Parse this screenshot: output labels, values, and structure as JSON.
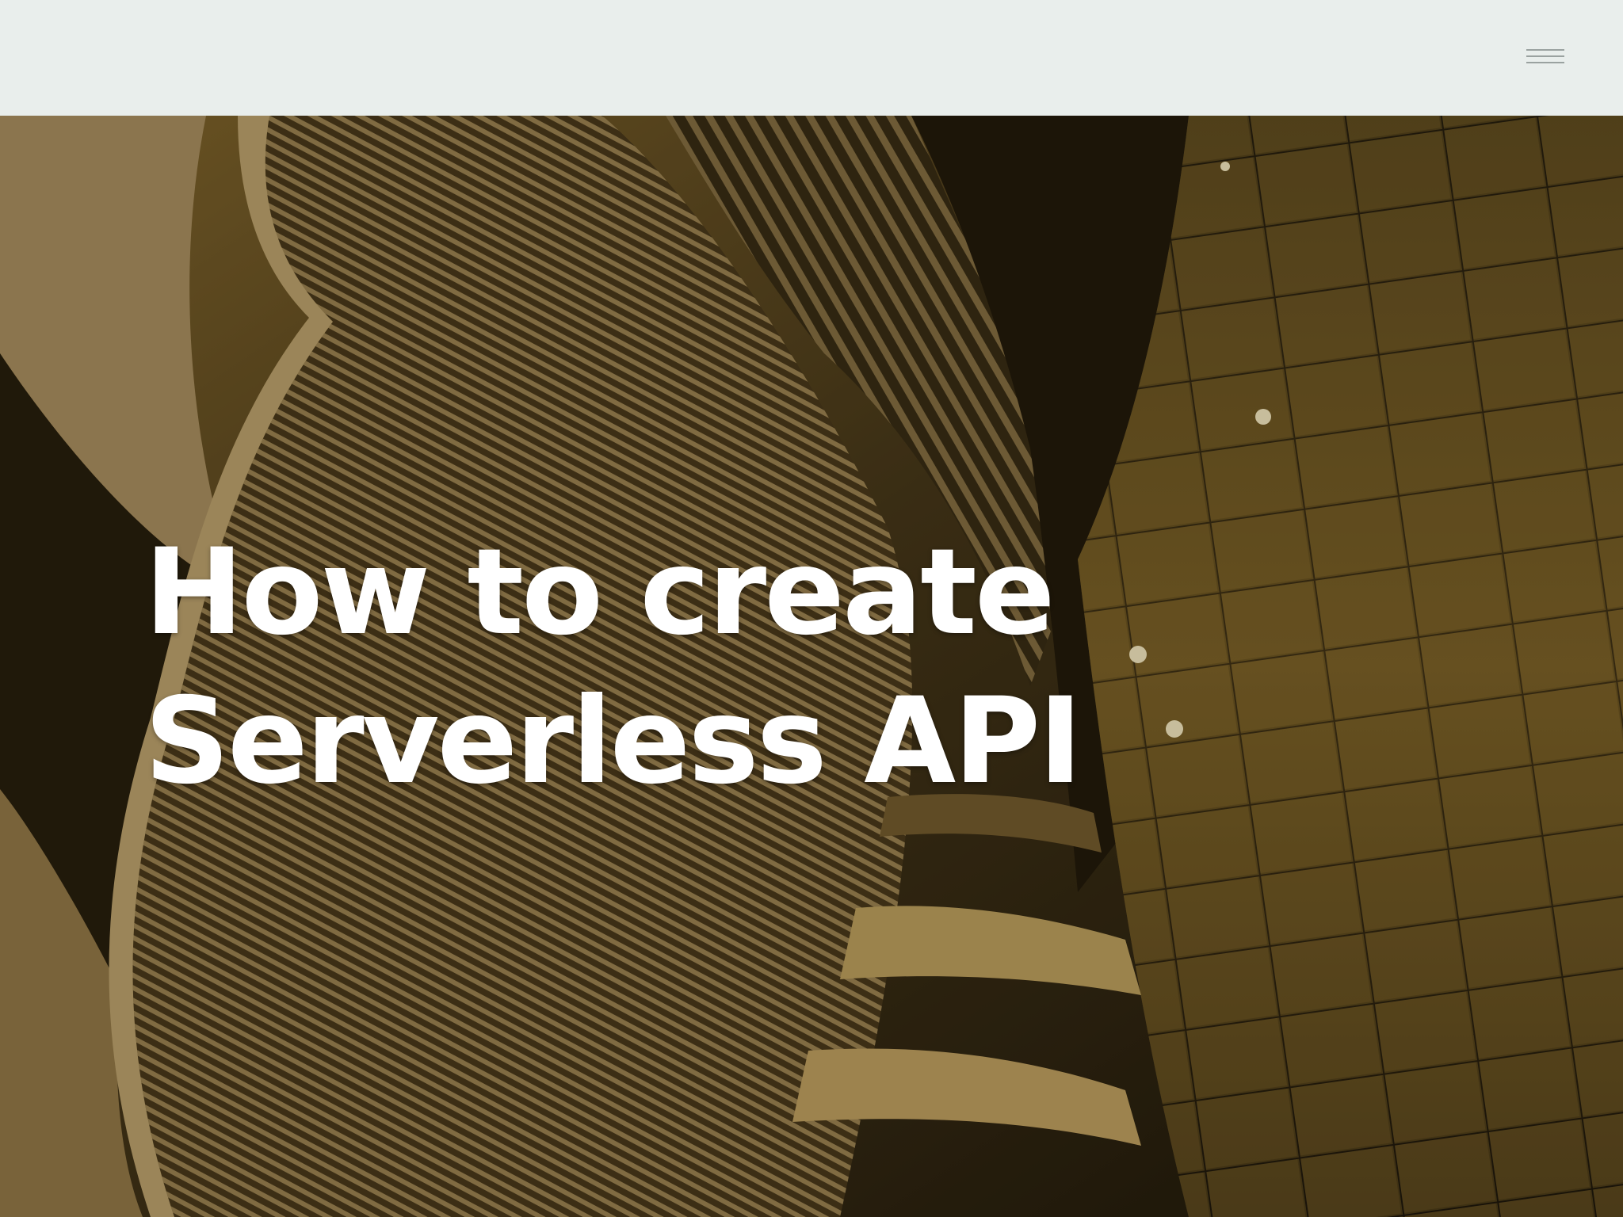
{
  "header": {
    "menu_icon": "hamburger-menu-icon",
    "background_color": "#e9eeec"
  },
  "hero": {
    "title_line_1": "How to create",
    "title_line_2": "Serverless API",
    "image_description_tint": "#6b5420",
    "text_color": "#ffffff"
  }
}
